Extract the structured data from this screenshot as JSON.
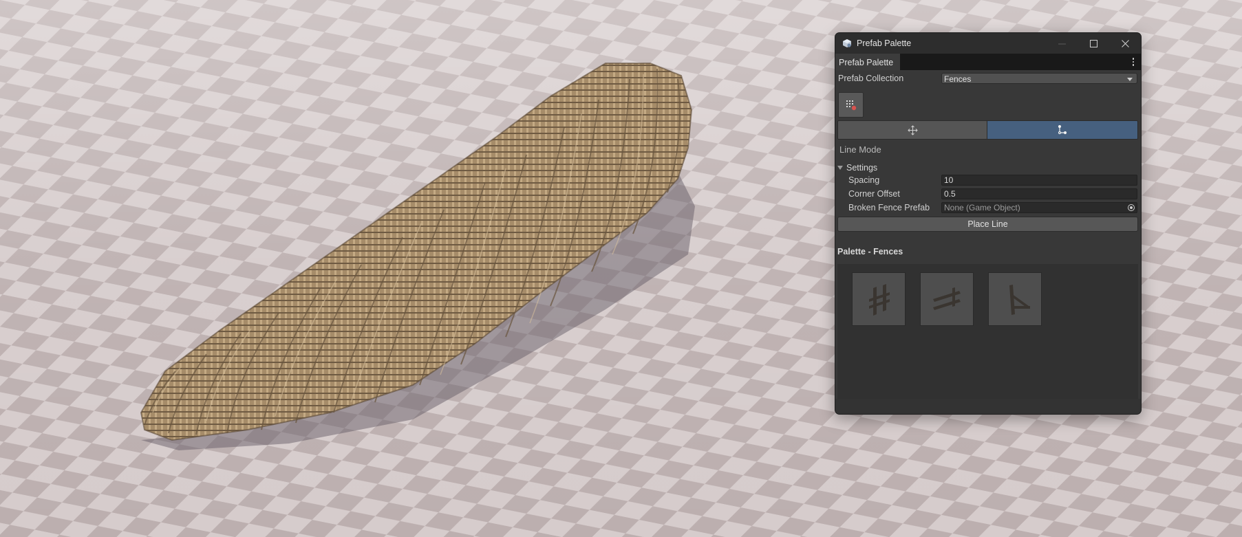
{
  "window": {
    "title": "Prefab Palette",
    "title_icon": "prefab-cube-icon",
    "controls": [
      "minimize-icon",
      "maximize-icon",
      "close-icon"
    ]
  },
  "tabs": [
    {
      "label": "Prefab Palette",
      "active": true
    }
  ],
  "collection": {
    "label": "Prefab Collection",
    "value": "Fences"
  },
  "tools": {
    "grid_tool_icon": "grid-tool-icon",
    "modes": [
      {
        "icon": "move-arrows-icon",
        "active": false
      },
      {
        "icon": "line-mode-icon",
        "active": true
      }
    ]
  },
  "mode_title": "Line Mode",
  "settings": {
    "label": "Settings",
    "expanded": true,
    "spacing": {
      "label": "Spacing",
      "value": "10"
    },
    "corner_offset": {
      "label": "Corner Offset",
      "value": "0.5"
    },
    "broken_fence": {
      "label": "Broken Fence Prefab",
      "value": "None (Game Object)"
    }
  },
  "place_button": "Place Line",
  "palette": {
    "title": "Palette - Fences",
    "items": [
      {
        "icon": "fence-post-icon"
      },
      {
        "icon": "fence-rail-icon"
      },
      {
        "icon": "fence-corner-icon"
      }
    ]
  },
  "colors": {
    "window_bg": "#383838",
    "active_mode": "#46607f",
    "ground_light": "#d6cccc",
    "ground_dark": "#b9abab",
    "fence": "#b49a76"
  }
}
